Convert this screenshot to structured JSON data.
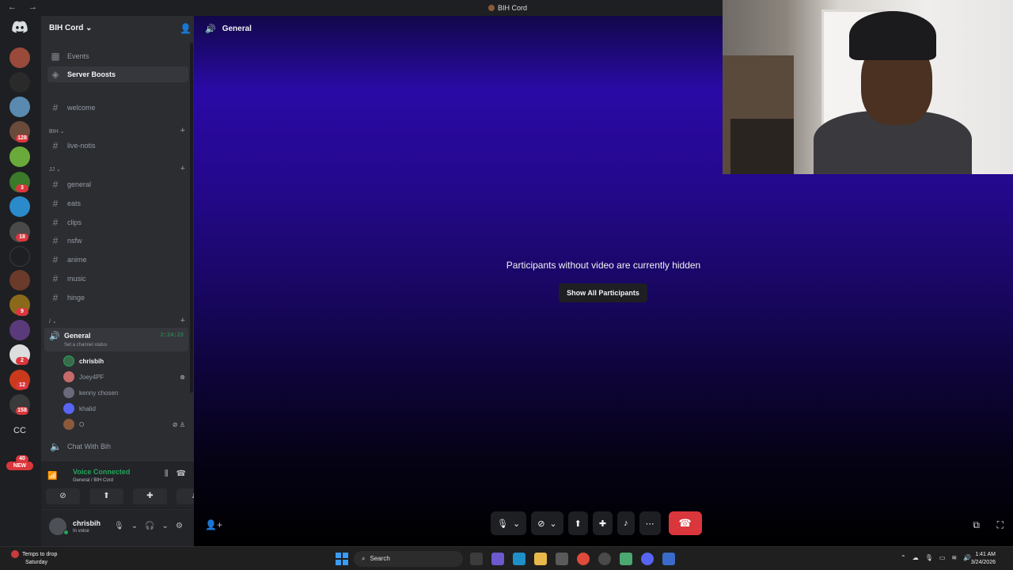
{
  "window": {
    "title": "BIH Cord",
    "nav": "← →"
  },
  "rail": {
    "badges": [
      "128",
      "3",
      "18",
      "9",
      "2",
      "12",
      "158",
      "40"
    ],
    "text_server": "CC",
    "new_label": "NEW"
  },
  "sidebar": {
    "server_name": "BIH Cord",
    "top_items": [
      {
        "label": "Events"
      },
      {
        "label": "Server Boosts"
      }
    ],
    "channels": {
      "welcome": "welcome",
      "cat_bih": "BIH",
      "live_notis": "live-notis",
      "cat_jj": "JJ",
      "general": "general",
      "eats": "eats",
      "clips": "clips",
      "nsfw": "nsfw",
      "anime": "anime",
      "music": "music",
      "hinge": "hinge",
      "cat_slash": "/"
    },
    "voice_channel": {
      "name": "General",
      "time": "2:24:23",
      "status": "Set a channel status",
      "users": [
        "chrisbih",
        "Joey4PF",
        "kenny chosen",
        "khalid",
        "O"
      ]
    },
    "chat_with": "Chat With Bih"
  },
  "voice_panel": {
    "title": "Voice Connected",
    "subtitle": "General / BIH Cord"
  },
  "user_panel": {
    "name": "chrisbih",
    "status": "In voice"
  },
  "stage": {
    "channel": "General",
    "hidden_message": "Participants without video are currently hidden",
    "show_button": "Show All Participants"
  },
  "taskbar": {
    "weather_title": "Temps to drop",
    "weather_sub": "Saturday",
    "search": "Search",
    "time": "1:41 AM",
    "date": "3/24/2026"
  },
  "colors": {
    "accent_green": "#23a559",
    "danger": "#da373c",
    "stage_purple": "#2a0aa6"
  }
}
